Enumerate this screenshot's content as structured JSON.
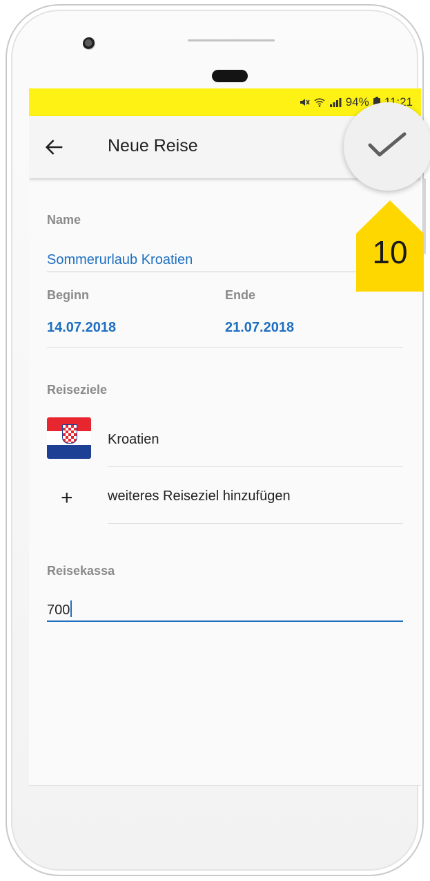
{
  "status_bar": {
    "battery": "94%",
    "time": "11:21"
  },
  "app_bar": {
    "back_icon": "arrow-left-icon",
    "title": "Neue Reise",
    "confirm_icon": "checkmark-icon"
  },
  "form": {
    "name_label": "Name",
    "name_value": "Sommerurlaub Kroatien",
    "start_label": "Beginn",
    "start_value": "14.07.2018",
    "end_label": "Ende",
    "end_value": "21.07.2018",
    "destinations_label": "Reiseziele",
    "destinations": [
      {
        "name": "Kroatien",
        "flag_icon": "croatia-flag-icon"
      }
    ],
    "add_destination_label": "weiteres Reiseziel hinzufügen",
    "add_icon": "plus-icon",
    "budget_label": "Reisekassa",
    "budget_value": "700"
  },
  "annotation": {
    "number": "10",
    "color": "#ffd700"
  },
  "colors": {
    "status_bar": "#fdf213",
    "accent": "#1e6fc0"
  }
}
